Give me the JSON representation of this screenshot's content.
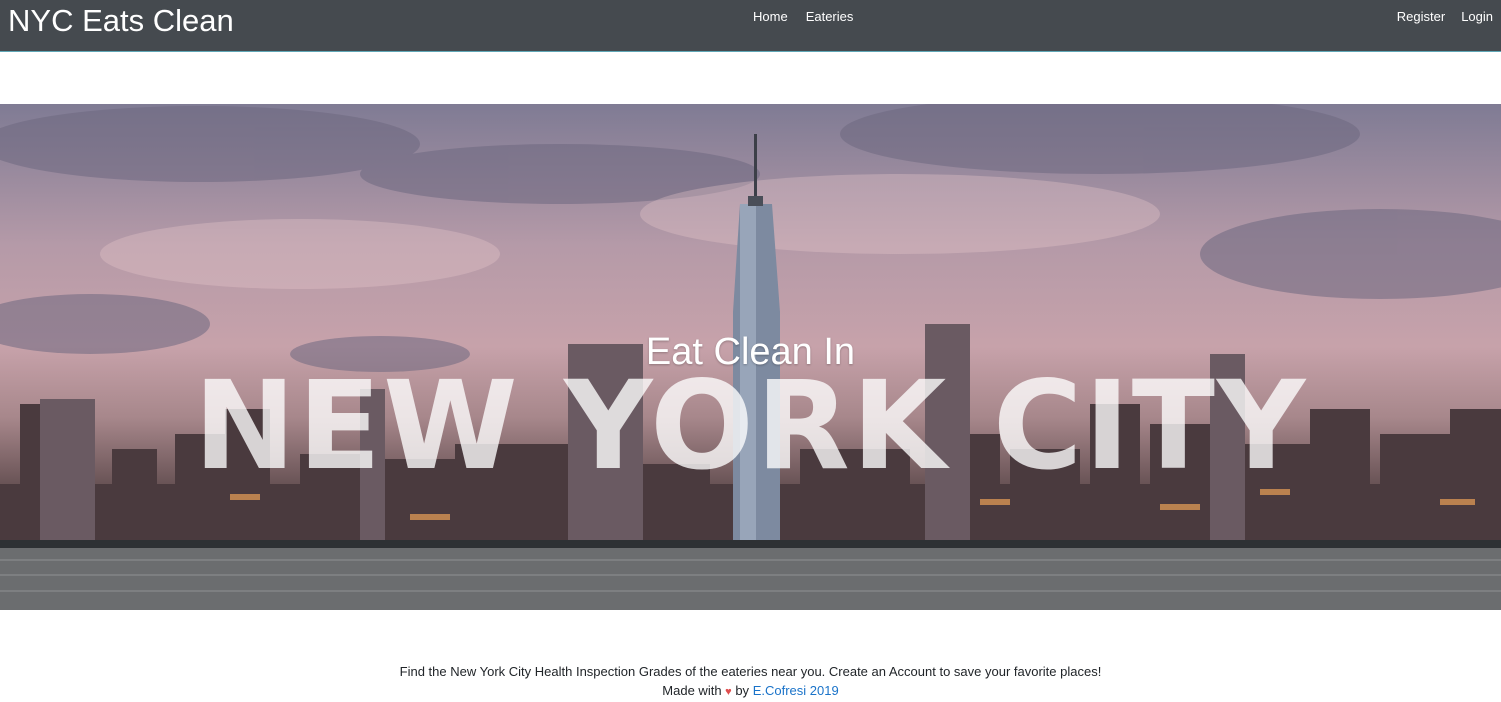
{
  "navbar": {
    "brand": "NYC Eats Clean",
    "center_links": [
      "Home",
      "Eateries"
    ],
    "right_links": [
      "Register",
      "Login"
    ]
  },
  "hero": {
    "subtitle": "Eat Clean In",
    "title": "NEW YORK CITY"
  },
  "footer": {
    "description": "Find the New York City Health Inspection Grades of the eateries near you. Create an Account to save your favorite places!",
    "made_with_prefix": "Made with",
    "heart_icon": "heart-icon",
    "by": "by",
    "author_link": "E.Cofresi 2019"
  },
  "colors": {
    "navbar_bg": "#454a4f",
    "link_blue": "#1a73c9",
    "heart": "#e04e4e"
  }
}
